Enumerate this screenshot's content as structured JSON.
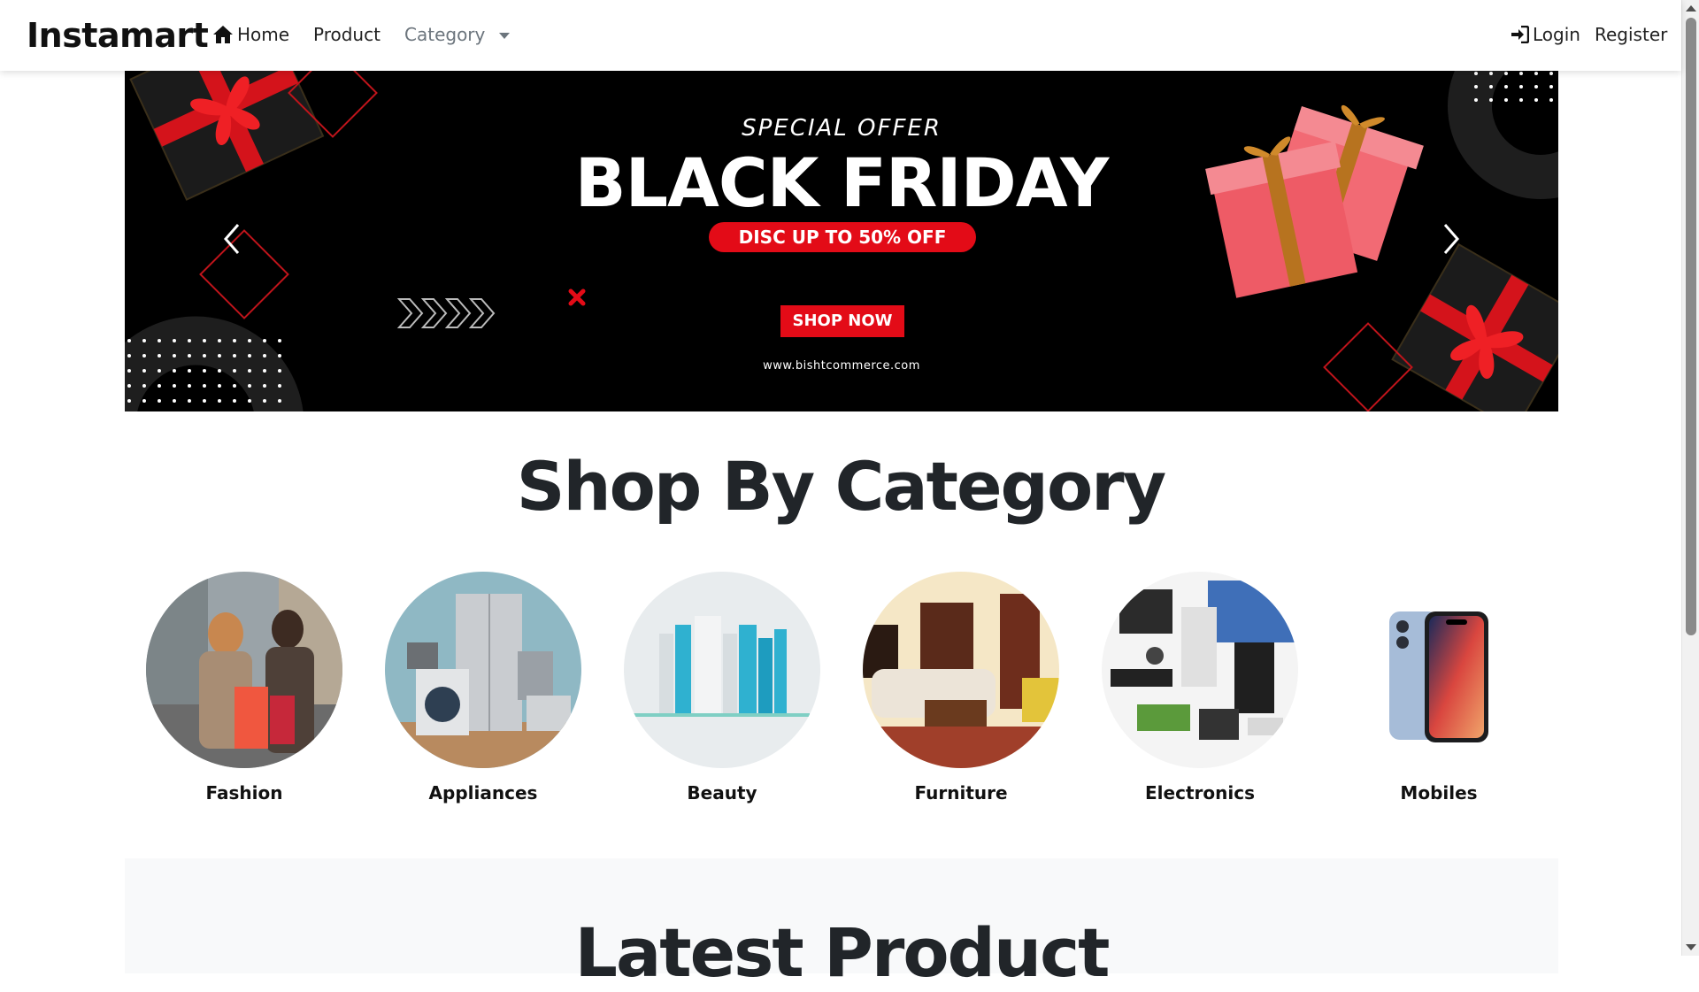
{
  "navbar": {
    "brand": "Instamart",
    "home": "Home",
    "product": "Product",
    "category": "Category",
    "login": "Login",
    "register": "Register"
  },
  "banner": {
    "special_offer": "SPECIAL OFFER",
    "headline": "BLACK FRIDAY",
    "discount": "DISC UP TO 50% OFF",
    "cta": "SHOP NOW",
    "website": "www.bishtcommerce.com"
  },
  "categories_section": {
    "title": "Shop By Category",
    "items": [
      {
        "label": "Fashion"
      },
      {
        "label": "Appliances"
      },
      {
        "label": "Beauty"
      },
      {
        "label": "Furniture"
      },
      {
        "label": "Electronics"
      },
      {
        "label": "Mobiles"
      }
    ]
  },
  "latest_section": {
    "title": "Latest Product"
  },
  "colors": {
    "accent_red": "#e30b17",
    "banner_bg": "#000000",
    "text_dark": "#212529",
    "nav_muted": "#6c757d",
    "section_bg": "#f8f9fa"
  },
  "icons": [
    "home-icon",
    "sign-in-icon",
    "caret-down-icon",
    "chevron-left-icon",
    "chevron-right-icon"
  ]
}
